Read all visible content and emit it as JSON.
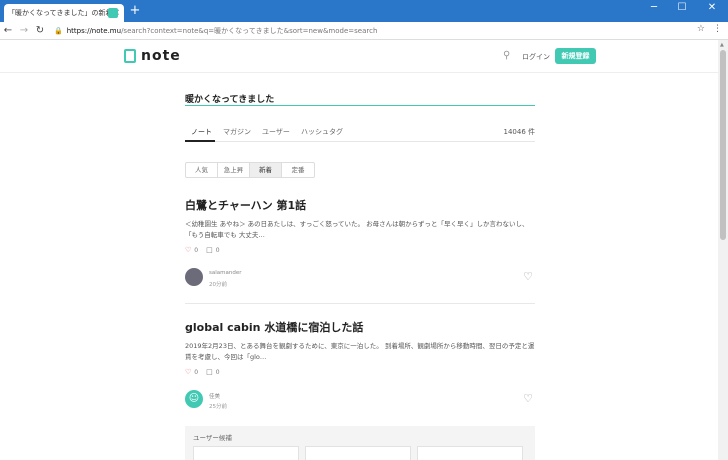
{
  "browser": {
    "tab_title": "「暖かくなってきました」の新着のノート",
    "tab_close": "×",
    "new_tab": "+",
    "win_min": "─",
    "win_max": "☐",
    "win_close": "✕",
    "url_host": "https://note.mu",
    "url_path": "/search?context=note&q=暖かくなってきました&sort=new&mode=search"
  },
  "header": {
    "logo_text": "note",
    "login_label": "ログイン",
    "signup_label": "新規登録"
  },
  "search": {
    "query": "暖かくなってきました"
  },
  "tabs": {
    "items": [
      "ノート",
      "マガジン",
      "ユーザー",
      "ハッシュタグ"
    ],
    "count": "14046 件"
  },
  "sort": {
    "options": [
      "人気",
      "急上昇",
      "新着",
      "定番"
    ],
    "selected": "新着"
  },
  "articles": [
    {
      "title": "白鷺とチャーハン 第1話",
      "excerpt": "＜幼稚園生 あやね＞ あの日あたしは、すっごく怒っていた。 お母さんは朝からずっと「早く早く」しか言わないし、「もう自転車でも 大丈夫…",
      "likes": "0",
      "comments": "0",
      "author": "salamander",
      "age": "20分前"
    },
    {
      "title": "global cabin 水道橋に宿泊した話",
      "excerpt": "2019年2月23日、とある舞台を観劇するために、東京に一泊した。 到着場所、観劇場所から移動時間、翌日の予定と運賃を考慮し、今回は「glo…",
      "likes": "0",
      "comments": "0",
      "author": "佳美",
      "age": "25分前"
    }
  ],
  "users_section": {
    "label": "ユーザー候補"
  },
  "colors": {
    "accent": "#41c9b4",
    "chrome": "#2a77c9",
    "like": "#e25b5b"
  },
  "icons": {
    "search": "search-icon",
    "heart": "heart-icon",
    "comment": "comment-icon",
    "bookmark_heart": "heart-outline-icon"
  }
}
